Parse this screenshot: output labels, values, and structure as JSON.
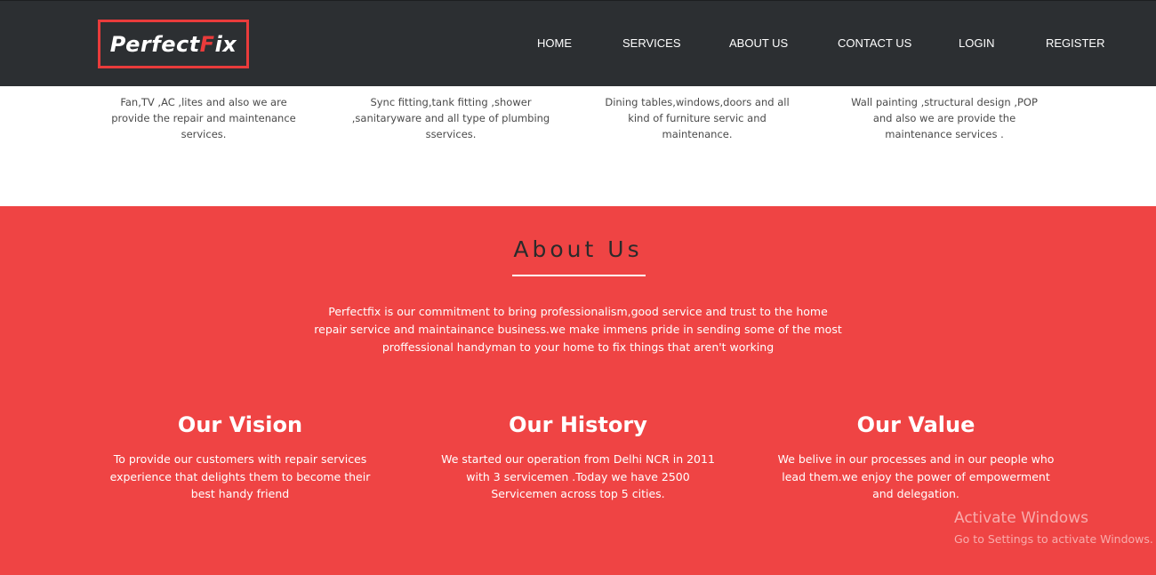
{
  "navbar": {
    "logo": {
      "part1": "Perfect",
      "part2": "F",
      "part3": "ix"
    },
    "items": [
      "HOME",
      "SERVICES",
      "ABOUT US",
      "CONTACT US",
      "LOGIN",
      "REGISTER"
    ]
  },
  "services": [
    {
      "text": "Fan,TV ,AC ,lites and also we are provide the repair and maintenance services."
    },
    {
      "text": "Sync fitting,tank fitting ,shower ,sanitaryware and all type of plumbing sservices."
    },
    {
      "text": "Dining tables,windows,doors and all kind of furniture servic and maintenance."
    },
    {
      "text": "Wall painting ,structural design ,POP and also we are provide the maintenance services ."
    }
  ],
  "about": {
    "title": "About Us",
    "text": "Perfectfix is our commitment to bring professionalism,good service and trust to the home repair service and maintainance business.we make immens pride in sending some of the most proffessional handyman to your home to fix things that aren't working",
    "columns": [
      {
        "title": "Our Vision",
        "text": "To provide our customers with repair services experience that delights them to become their best handy friend"
      },
      {
        "title": "Our History",
        "text": "We started our operation from Delhi NCR in 2011 with 3 servicemen .Today we have 2500 Servicemen across top 5 cities."
      },
      {
        "title": "Our Value",
        "text": "We belive in our processes and in our people who lead them.we enjoy the power of empowerment and delegation."
      }
    ]
  },
  "watermark": {
    "title": "Activate Windows",
    "subtitle": "Go to Settings to activate Windows."
  },
  "colors": {
    "navbar": "#2c2f32",
    "accent": "#e93b3b",
    "about_bg": "#ef4444"
  }
}
